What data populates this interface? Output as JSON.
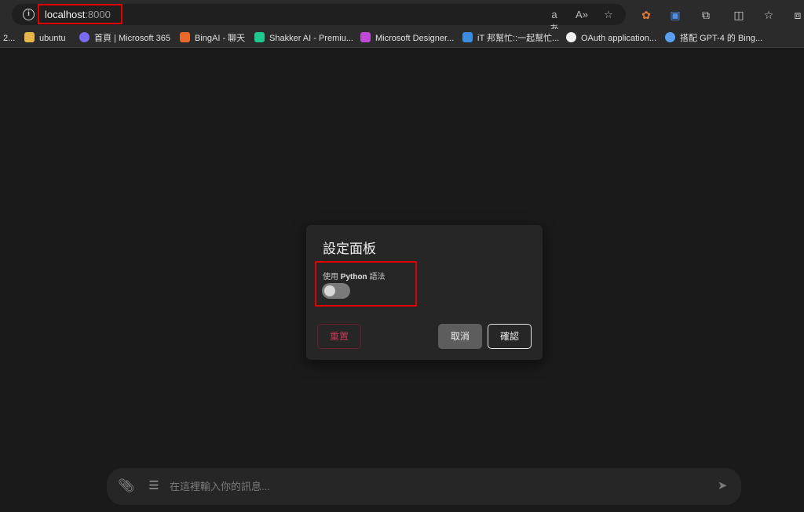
{
  "browser": {
    "url_host": "localhost",
    "url_port": ":8000",
    "toolbar_icons": [
      "translate-icon",
      "read-aloud-icon",
      "favorite-star-icon",
      "extension-icon",
      "translate-ext-icon",
      "puzzle-icon",
      "split-screen-icon",
      "favorites-icon",
      "collections-icon"
    ],
    "bookmarks": [
      {
        "label": "2...",
        "color": "#888888"
      },
      {
        "label": "ubuntu",
        "color": "#e8b54a"
      },
      {
        "label": "首頁 | Microsoft 365",
        "color": "#7a6cf2"
      },
      {
        "label": "BingAI - 聊天",
        "color": "#e8692b"
      },
      {
        "label": "Shakker AI - Premiu...",
        "color": "#1ec98f"
      },
      {
        "label": "Microsoft Designer...",
        "color": "#c04ad8"
      },
      {
        "label": "iT 邦幫忙::一起幫忙...",
        "color": "#3a8de0"
      },
      {
        "label": "OAuth application...",
        "color": "#f0f0f0"
      },
      {
        "label": "搭配 GPT-4 的 Bing...",
        "color": "#5aa0f0"
      }
    ]
  },
  "dialog": {
    "title": "設定面板",
    "option_prefix": "使用",
    "option_bold": "Python",
    "option_suffix": "語法",
    "toggle_on": false,
    "reset_label": "重置",
    "cancel_label": "取消",
    "confirm_label": "確認"
  },
  "chat": {
    "placeholder": "在這裡輸入你的訊息..."
  }
}
